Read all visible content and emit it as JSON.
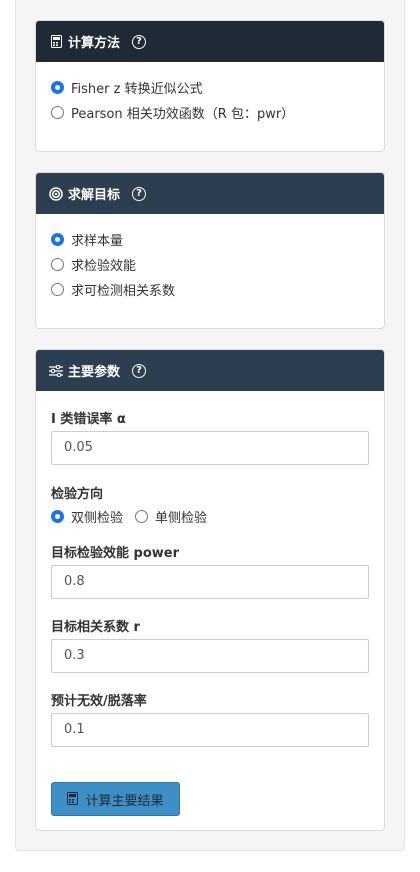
{
  "method_panel": {
    "title": "计算方法",
    "help": "?",
    "options": [
      {
        "label": "Fisher z 转换近似公式",
        "selected": true
      },
      {
        "label": "Pearson 相关功效函数（R 包：pwr）",
        "selected": false
      }
    ]
  },
  "target_panel": {
    "title": "求解目标",
    "help": "?",
    "options": [
      {
        "label": "求样本量",
        "selected": true
      },
      {
        "label": "求检验效能",
        "selected": false
      },
      {
        "label": "求可检测相关系数",
        "selected": false
      }
    ]
  },
  "params_panel": {
    "title": "主要参数",
    "help": "?",
    "alpha": {
      "label": "I 类错误率 α",
      "value": "0.05"
    },
    "direction": {
      "label": "检验方向",
      "options": [
        {
          "label": "双侧检验",
          "selected": true
        },
        {
          "label": "单侧检验",
          "selected": false
        }
      ]
    },
    "power": {
      "label": "目标检验效能 power",
      "value": "0.8"
    },
    "r": {
      "label": "目标相关系数 r",
      "value": "0.3"
    },
    "dropout": {
      "label": "预计无效/脱落率",
      "value": "0.1"
    },
    "compute_button": "计算主要结果"
  },
  "colors": {
    "header_dark": "#1f2a36",
    "header_slate": "#2c3e50",
    "button": "#3f8fc7",
    "radio_on": "#1a73e8"
  }
}
